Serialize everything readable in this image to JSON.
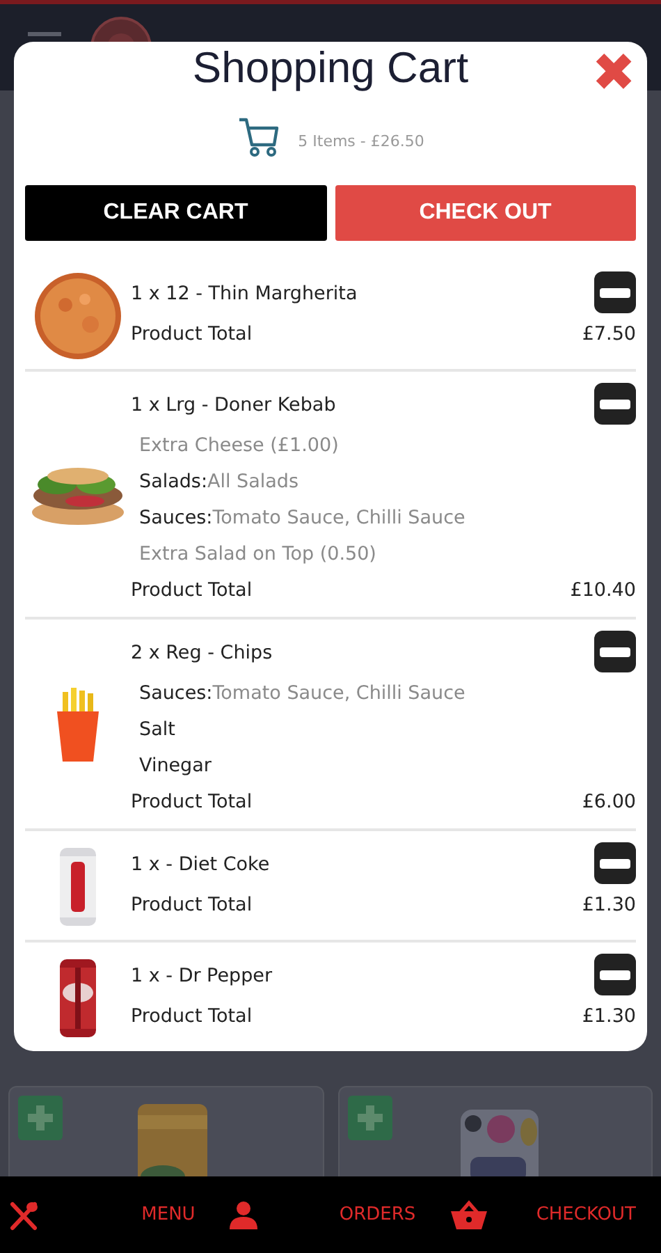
{
  "cart": {
    "title": "Shopping Cart",
    "close": "✖",
    "summary": "5 Items - £26.50",
    "buttons": [
      {
        "label": "CLEAR CART",
        "kind": "secondary"
      },
      {
        "label": "CHECK OUT",
        "kind": "primary"
      }
    ],
    "items": [
      {
        "title": "1 x 12 - Thin Margherita",
        "total_label": "Product Total",
        "total": "£7.50"
      },
      {
        "title": "1 x Lrg - Doner Kebab",
        "options": [
          {
            "value": "Extra Cheese (£1.00)"
          },
          {
            "label": "Salads:",
            "value": "All Salads"
          },
          {
            "label": "Sauces:",
            "value": "Tomato Sauce, Chilli Sauce"
          },
          {
            "value": "Extra Salad on Top (0.50)"
          }
        ],
        "total_label": "Product Total",
        "total": "£10.40"
      },
      {
        "title": "2 x Reg - Chips",
        "options": [
          {
            "label": "Sauces:",
            "value": "Tomato Sauce, Chilli Sauce"
          },
          {
            "label": "Salt"
          },
          {
            "label": "Vinegar"
          }
        ],
        "total_label": "Product Total",
        "total": "£6.00"
      },
      {
        "title": "1 x - Diet Coke",
        "total_label": "Product Total",
        "total": "£1.30"
      },
      {
        "title": "1 x - Dr Pepper",
        "total_label": "Product Total",
        "total": "£1.30"
      }
    ]
  },
  "bottom_nav": [
    {
      "label": "MENU"
    },
    {
      "label": "ORDERS"
    },
    {
      "label": "CHECKOUT"
    }
  ]
}
